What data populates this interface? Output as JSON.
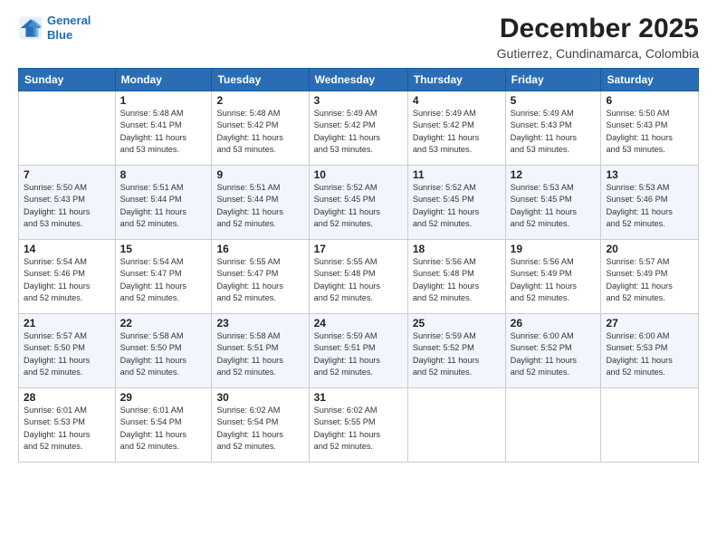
{
  "logo": {
    "line1": "General",
    "line2": "Blue"
  },
  "title": "December 2025",
  "location": "Gutierrez, Cundinamarca, Colombia",
  "headers": [
    "Sunday",
    "Monday",
    "Tuesday",
    "Wednesday",
    "Thursday",
    "Friday",
    "Saturday"
  ],
  "weeks": [
    [
      {
        "day": "",
        "info": ""
      },
      {
        "day": "1",
        "info": "Sunrise: 5:48 AM\nSunset: 5:41 PM\nDaylight: 11 hours\nand 53 minutes."
      },
      {
        "day": "2",
        "info": "Sunrise: 5:48 AM\nSunset: 5:42 PM\nDaylight: 11 hours\nand 53 minutes."
      },
      {
        "day": "3",
        "info": "Sunrise: 5:49 AM\nSunset: 5:42 PM\nDaylight: 11 hours\nand 53 minutes."
      },
      {
        "day": "4",
        "info": "Sunrise: 5:49 AM\nSunset: 5:42 PM\nDaylight: 11 hours\nand 53 minutes."
      },
      {
        "day": "5",
        "info": "Sunrise: 5:49 AM\nSunset: 5:43 PM\nDaylight: 11 hours\nand 53 minutes."
      },
      {
        "day": "6",
        "info": "Sunrise: 5:50 AM\nSunset: 5:43 PM\nDaylight: 11 hours\nand 53 minutes."
      }
    ],
    [
      {
        "day": "7",
        "info": "Sunrise: 5:50 AM\nSunset: 5:43 PM\nDaylight: 11 hours\nand 53 minutes."
      },
      {
        "day": "8",
        "info": "Sunrise: 5:51 AM\nSunset: 5:44 PM\nDaylight: 11 hours\nand 52 minutes."
      },
      {
        "day": "9",
        "info": "Sunrise: 5:51 AM\nSunset: 5:44 PM\nDaylight: 11 hours\nand 52 minutes."
      },
      {
        "day": "10",
        "info": "Sunrise: 5:52 AM\nSunset: 5:45 PM\nDaylight: 11 hours\nand 52 minutes."
      },
      {
        "day": "11",
        "info": "Sunrise: 5:52 AM\nSunset: 5:45 PM\nDaylight: 11 hours\nand 52 minutes."
      },
      {
        "day": "12",
        "info": "Sunrise: 5:53 AM\nSunset: 5:45 PM\nDaylight: 11 hours\nand 52 minutes."
      },
      {
        "day": "13",
        "info": "Sunrise: 5:53 AM\nSunset: 5:46 PM\nDaylight: 11 hours\nand 52 minutes."
      }
    ],
    [
      {
        "day": "14",
        "info": "Sunrise: 5:54 AM\nSunset: 5:46 PM\nDaylight: 11 hours\nand 52 minutes."
      },
      {
        "day": "15",
        "info": "Sunrise: 5:54 AM\nSunset: 5:47 PM\nDaylight: 11 hours\nand 52 minutes."
      },
      {
        "day": "16",
        "info": "Sunrise: 5:55 AM\nSunset: 5:47 PM\nDaylight: 11 hours\nand 52 minutes."
      },
      {
        "day": "17",
        "info": "Sunrise: 5:55 AM\nSunset: 5:48 PM\nDaylight: 11 hours\nand 52 minutes."
      },
      {
        "day": "18",
        "info": "Sunrise: 5:56 AM\nSunset: 5:48 PM\nDaylight: 11 hours\nand 52 minutes."
      },
      {
        "day": "19",
        "info": "Sunrise: 5:56 AM\nSunset: 5:49 PM\nDaylight: 11 hours\nand 52 minutes."
      },
      {
        "day": "20",
        "info": "Sunrise: 5:57 AM\nSunset: 5:49 PM\nDaylight: 11 hours\nand 52 minutes."
      }
    ],
    [
      {
        "day": "21",
        "info": "Sunrise: 5:57 AM\nSunset: 5:50 PM\nDaylight: 11 hours\nand 52 minutes."
      },
      {
        "day": "22",
        "info": "Sunrise: 5:58 AM\nSunset: 5:50 PM\nDaylight: 11 hours\nand 52 minutes."
      },
      {
        "day": "23",
        "info": "Sunrise: 5:58 AM\nSunset: 5:51 PM\nDaylight: 11 hours\nand 52 minutes."
      },
      {
        "day": "24",
        "info": "Sunrise: 5:59 AM\nSunset: 5:51 PM\nDaylight: 11 hours\nand 52 minutes."
      },
      {
        "day": "25",
        "info": "Sunrise: 5:59 AM\nSunset: 5:52 PM\nDaylight: 11 hours\nand 52 minutes."
      },
      {
        "day": "26",
        "info": "Sunrise: 6:00 AM\nSunset: 5:52 PM\nDaylight: 11 hours\nand 52 minutes."
      },
      {
        "day": "27",
        "info": "Sunrise: 6:00 AM\nSunset: 5:53 PM\nDaylight: 11 hours\nand 52 minutes."
      }
    ],
    [
      {
        "day": "28",
        "info": "Sunrise: 6:01 AM\nSunset: 5:53 PM\nDaylight: 11 hours\nand 52 minutes."
      },
      {
        "day": "29",
        "info": "Sunrise: 6:01 AM\nSunset: 5:54 PM\nDaylight: 11 hours\nand 52 minutes."
      },
      {
        "day": "30",
        "info": "Sunrise: 6:02 AM\nSunset: 5:54 PM\nDaylight: 11 hours\nand 52 minutes."
      },
      {
        "day": "31",
        "info": "Sunrise: 6:02 AM\nSunset: 5:55 PM\nDaylight: 11 hours\nand 52 minutes."
      },
      {
        "day": "",
        "info": ""
      },
      {
        "day": "",
        "info": ""
      },
      {
        "day": "",
        "info": ""
      }
    ]
  ]
}
